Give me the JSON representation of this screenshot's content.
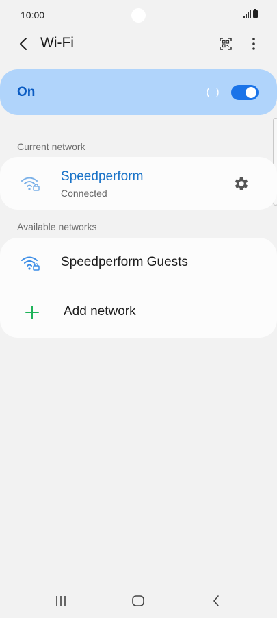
{
  "status_bar": {
    "time": "10:00"
  },
  "header": {
    "title": "Wi-Fi"
  },
  "wifi_switch": {
    "label": "On",
    "state": "on"
  },
  "sections": {
    "current": "Current network",
    "available": "Available networks"
  },
  "current_network": {
    "name": "Speedperform",
    "status": "Connected"
  },
  "available_networks": [
    {
      "name": "Speedperform Guests"
    }
  ],
  "add_network_label": "Add network",
  "colors": {
    "accent": "#1a73e8",
    "switch_bg": "#b0d4fb",
    "add_icon": "#1fb35a"
  },
  "icons": {
    "back": "chevron-left-icon",
    "qr": "qr-code-icon",
    "more": "more-vertical-icon",
    "wifi_locked": "wifi-lock-icon",
    "settings": "gear-icon",
    "add": "plus-icon"
  }
}
